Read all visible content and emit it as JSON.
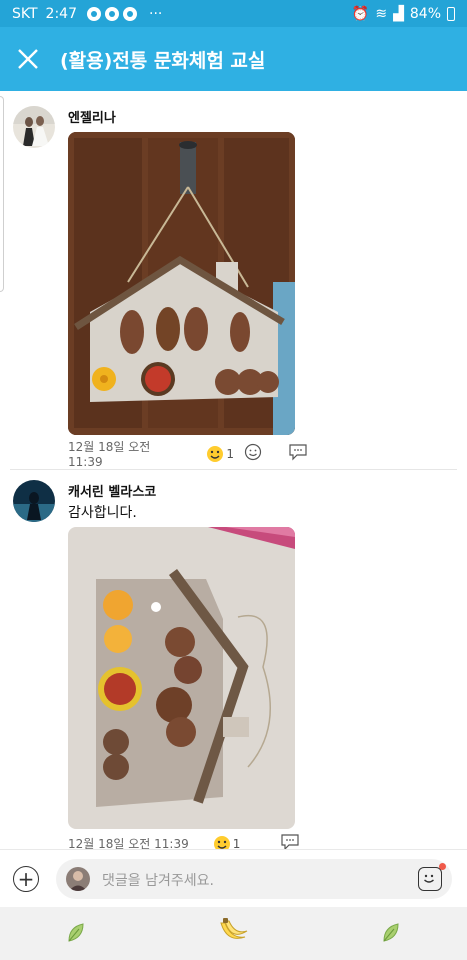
{
  "status": {
    "carrier": "SKT",
    "time": "2:47",
    "battery": "84%"
  },
  "header": {
    "title": "(활용)전통 문화체험 교실",
    "close_icon": "close-icon"
  },
  "comments": [
    {
      "author": "엔젤리나",
      "text": "",
      "date": "12월 18일 오전 11:39",
      "emoji_count": "1"
    },
    {
      "author": "캐서린 벨라스코",
      "text": "감사합니다.",
      "date": "12월 18일 오전 11:39",
      "emoji_count": "1"
    }
  ],
  "composer": {
    "placeholder": "댓글을 남겨주세요."
  },
  "icons": {
    "add": "plus-circle-icon",
    "emoji": "emoji-icon",
    "leaf": "leaf-icon",
    "banana": "banana-icon"
  },
  "colors": {
    "statusbar": "#24a4d7",
    "appbar": "#2fb0e3",
    "accent": "#f05a4a"
  }
}
